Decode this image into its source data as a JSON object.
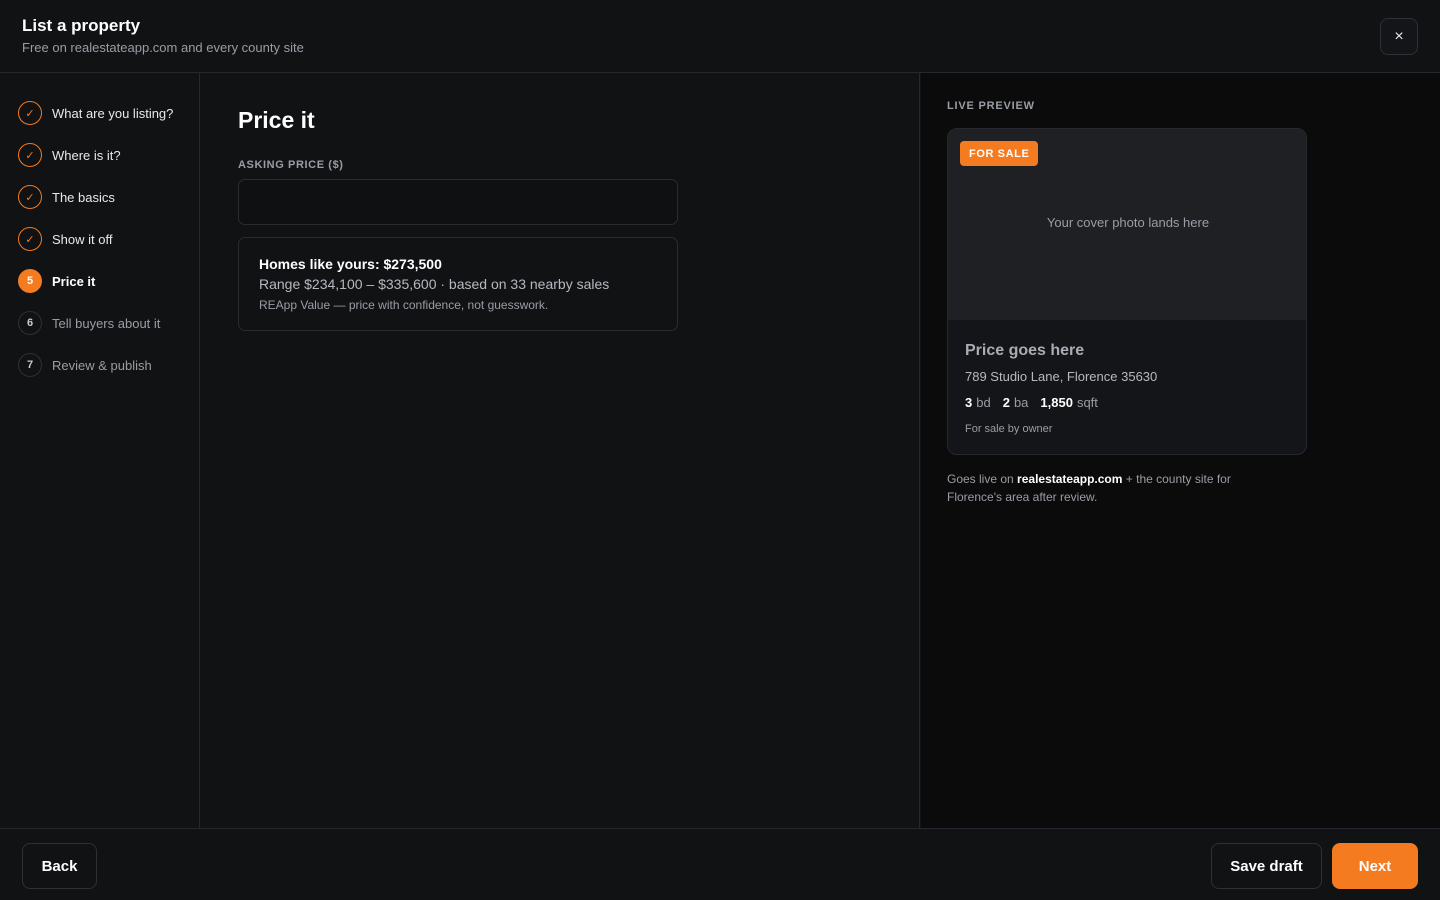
{
  "header": {
    "title": "List a property",
    "subtitle": "Free on realestateapp.com and every county site",
    "close_icon": "×"
  },
  "steps": [
    {
      "marker": "✓",
      "label": "What are you listing?",
      "state": "done"
    },
    {
      "marker": "✓",
      "label": "Where is it?",
      "state": "done"
    },
    {
      "marker": "✓",
      "label": "The basics",
      "state": "done"
    },
    {
      "marker": "✓",
      "label": "Show it off",
      "state": "done"
    },
    {
      "marker": "5",
      "label": "Price it",
      "state": "active"
    },
    {
      "marker": "6",
      "label": "Tell buyers about it",
      "state": "todo"
    },
    {
      "marker": "7",
      "label": "Review & publish",
      "state": "todo"
    }
  ],
  "main": {
    "title": "Price it",
    "price_label": "ASKING PRICE ($)",
    "price_value": "",
    "estimate": {
      "line1": "Homes like yours: $273,500",
      "line2": "Range $234,100 – $335,600 · based on 33 nearby sales",
      "line3": "REApp Value — price with confidence, not guesswork."
    }
  },
  "preview": {
    "heading": "LIVE PREVIEW",
    "badge": "FOR SALE",
    "photo_placeholder": "Your cover photo lands here",
    "price": "Price goes here",
    "address": "789 Studio Lane, Florence 35630",
    "beds": "3",
    "beds_unit": "bd",
    "baths": "2",
    "baths_unit": "ba",
    "sqft": "1,850",
    "sqft_unit": "sqft",
    "owner": "For sale by owner",
    "golive_prefix": "Goes live on ",
    "golive_site": "realestateapp.com",
    "golive_suffix": " + the county site for Florence's area after review."
  },
  "footer": {
    "back": "Back",
    "save": "Save draft",
    "next": "Next"
  },
  "colors": {
    "accent": "#f47b20",
    "background": "#111214",
    "preview_background": "#0b0b0c"
  }
}
